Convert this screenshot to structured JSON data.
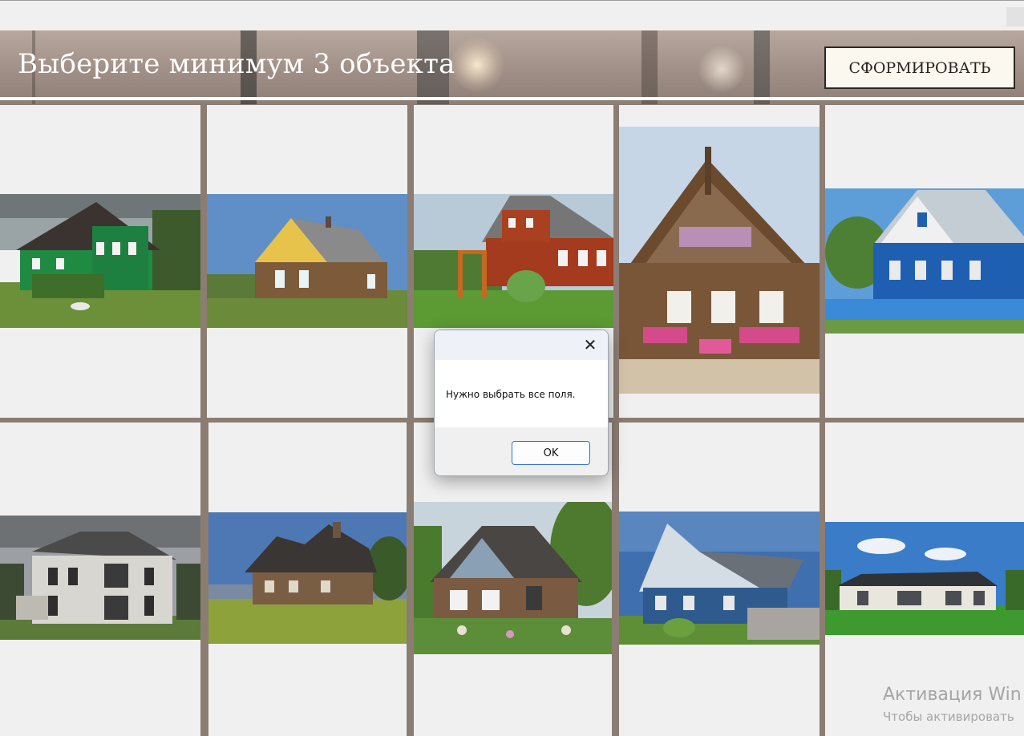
{
  "header": {
    "title": "Выберите минимум 3 объекта",
    "button_label": "СФОРМИРОВАТЬ"
  },
  "cards": [
    {
      "name": "green-wooden-house",
      "icon": "house-photo"
    },
    {
      "name": "yellow-gable-log-house",
      "icon": "house-photo"
    },
    {
      "name": "red-two-story-house",
      "icon": "house-photo"
    },
    {
      "name": "carved-log-house-flowers",
      "icon": "house-photo"
    },
    {
      "name": "blue-village-house",
      "icon": "house-photo"
    },
    {
      "name": "abandoned-white-mansion",
      "icon": "house-photo"
    },
    {
      "name": "wooden-chalet-house",
      "icon": "house-photo"
    },
    {
      "name": "glass-gable-log-house",
      "icon": "house-photo"
    },
    {
      "name": "blue-carved-cottage",
      "icon": "house-photo"
    },
    {
      "name": "modern-white-bungalow",
      "icon": "house-photo"
    }
  ],
  "dialog": {
    "message": "Нужно выбрать все поля.",
    "ok_label": "OK",
    "close_icon": "close-icon"
  },
  "watermark": {
    "title": "Активация Win",
    "subtitle": "Чтобы активировать"
  }
}
